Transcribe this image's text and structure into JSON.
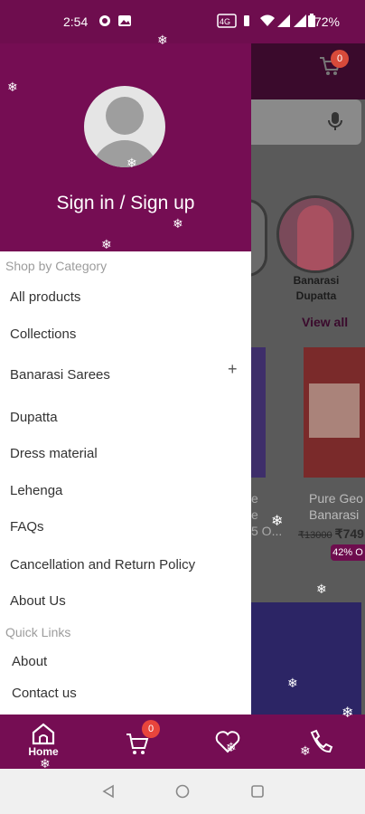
{
  "status_bar": {
    "time": "2:54",
    "battery": "72%"
  },
  "drawer": {
    "signin_label": "Sign in / Sign up",
    "shop_by_category_label": "Shop by Category",
    "categories": [
      {
        "label": "All products"
      },
      {
        "label": "Collections"
      },
      {
        "label": "Banarasi Sarees"
      },
      {
        "label": "Dupatta"
      },
      {
        "label": "Dress material"
      },
      {
        "label": "Lehenga"
      },
      {
        "label": "FAQs"
      },
      {
        "label": "Cancellation and Return Policy"
      },
      {
        "label": "About Us"
      }
    ],
    "quick_links_label": "Quick Links",
    "quick_links": [
      {
        "label": "About"
      },
      {
        "label": "Contact us"
      }
    ]
  },
  "background": {
    "cart_count": "0",
    "category_name": "Banarasi Dupatta",
    "view_all": "View all",
    "product_1_text": "e",
    "product_2_title": "Pure Geo",
    "product_2_sub": "Banarasi",
    "product_1_sub": "e",
    "product_1_ellipsis": "5 O...",
    "product_2_old_price": "₹13000",
    "product_2_price": "₹749",
    "product_2_discount": "42% O"
  },
  "bottom_nav": {
    "home_label": "Home",
    "cart_count": "0"
  },
  "colors": {
    "brand": "#750d53",
    "status_bar": "#6e0d4e",
    "badge": "#e8453c"
  }
}
